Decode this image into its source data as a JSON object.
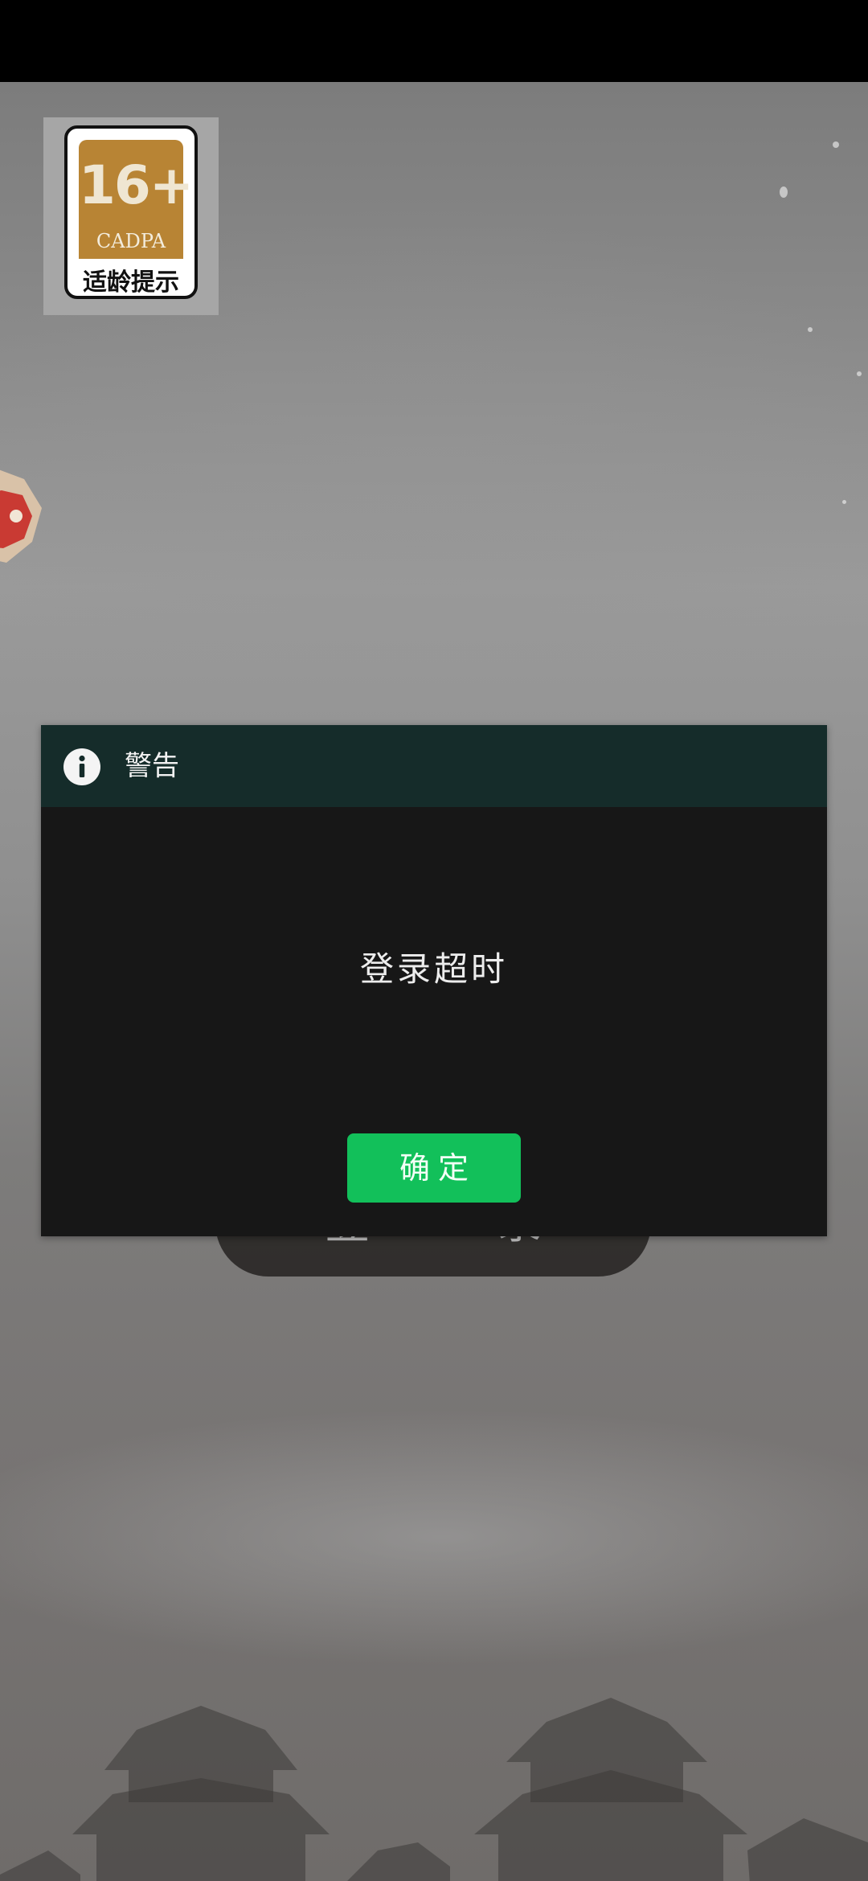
{
  "age_rating": {
    "number": "16+",
    "org": "CADPA",
    "caption": "适龄提示"
  },
  "login_button": {
    "label": "登 录"
  },
  "dialog": {
    "title": "警告",
    "message": "登录超时",
    "confirm_label": "确定"
  },
  "icons": {
    "info": "info-icon",
    "side_widget": "side-float-icon"
  },
  "colors": {
    "dialog_header": "#152c2a",
    "dialog_body": "#171717",
    "confirm_button": "#12c05a",
    "age_badge_orange": "#b88434"
  }
}
